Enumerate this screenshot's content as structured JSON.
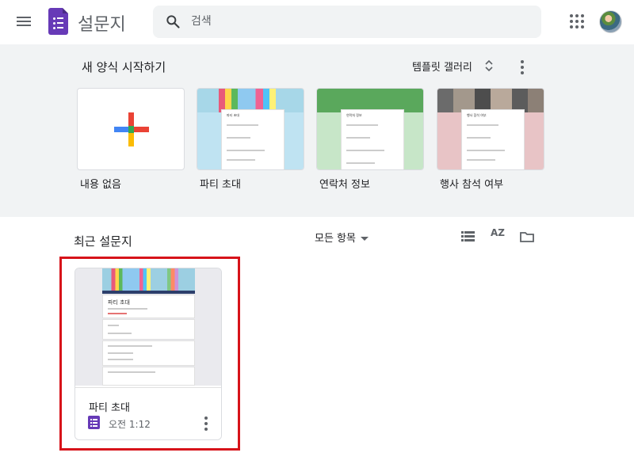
{
  "header": {
    "app_title": "설문지",
    "search_placeholder": "검색",
    "icons": [
      "menu-icon",
      "forms-logo-icon",
      "search-icon",
      "apps-icon",
      "avatar"
    ]
  },
  "gallery": {
    "heading": "새 양식 시작하기",
    "gallery_link": "템플릿 갤러리",
    "templates": [
      {
        "label": "내용 없음"
      },
      {
        "label": "파티 초대",
        "thumb_title": "파티 초대"
      },
      {
        "label": "연락처 정보",
        "thumb_title": "연락처 정보"
      },
      {
        "label": "행사 참석 여부",
        "thumb_title": "행사 참석 여부"
      }
    ]
  },
  "recent": {
    "heading": "최근 설문지",
    "owner_filter": "모든 항목",
    "sort_label": "AZ",
    "documents": [
      {
        "title": "파티 초대",
        "time": "오전 1:12",
        "preview_title": "파티 초대"
      }
    ]
  },
  "colors": {
    "brand_purple": "#673ab7",
    "highlight_red": "#d7131a",
    "gallery_bg": "#f1f3f4"
  }
}
